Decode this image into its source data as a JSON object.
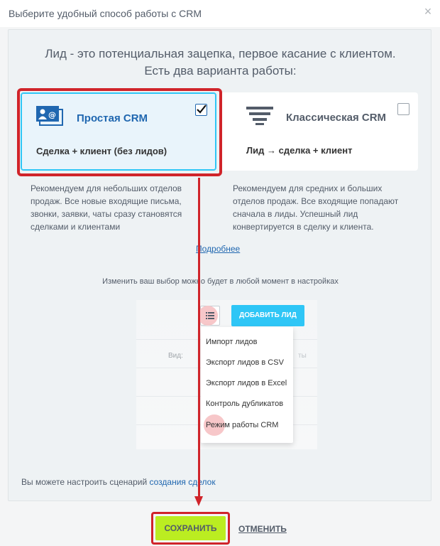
{
  "header": {
    "title": "Выберите удобный способ работы с CRM",
    "close_icon": "close-icon"
  },
  "intro": {
    "line1": "Лид - это потенциальная зацепка, первое касание с клиентом.",
    "line2": "Есть два варианта работы:"
  },
  "options": [
    {
      "title": "Простая CRM",
      "subtitle": "Сделка + клиент (без лидов)",
      "icon": "contact-card-icon",
      "checked": true,
      "description": "Рекомендуем для небольших отделов продаж. Все новые входящие письма, звонки, заявки, чаты сразу становятся сделками и клиентами"
    },
    {
      "title": "Классическая CRM",
      "subtitle": "Лид → сделка + клиент",
      "icon": "funnel-icon",
      "checked": false,
      "description": "Рекомендуем для средних и больших отделов продаж. Все входящие попадают сначала в лиды. Успешный лид конвертируется в сделку и клиента."
    }
  ],
  "more_link": "Подробнее",
  "change_note": "Изменить ваш выбор можно будет в любой момент в настройках",
  "preview": {
    "add_lead_button": "ДОБАВИТЬ ЛИД",
    "view_label": "Вид:",
    "column_hint": "ты",
    "menu": [
      "Импорт лидов",
      "Экспорт лидов в CSV",
      "Экспорт лидов в Excel",
      "Контроль дубликатов",
      "Режим работы CRM"
    ]
  },
  "footer_note": {
    "text": "Вы можете настроить сценарий ",
    "link": "создания сделок"
  },
  "actions": {
    "save": "СОХРАНИТЬ",
    "cancel": "ОТМЕНИТЬ"
  },
  "colors": {
    "accent": "#2fc6f6",
    "save": "#bbed21",
    "highlight": "#d0242a",
    "link": "#2067b0"
  }
}
